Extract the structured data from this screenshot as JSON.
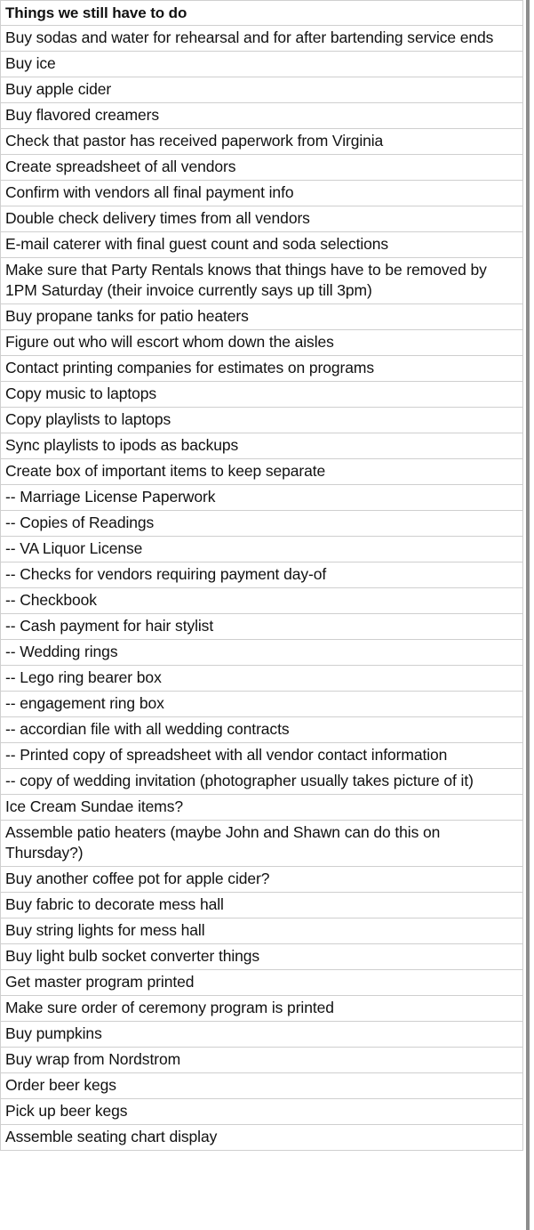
{
  "document": {
    "title": "Things we still have to do",
    "kind": "checklist-table",
    "column_count": 1
  },
  "table": {
    "header": "Things we still have to do",
    "rows": [
      "Buy sodas and water for rehearsal and for after bartending service ends",
      "Buy ice",
      "Buy apple cider",
      "Buy flavored creamers",
      "Check that pastor has received paperwork from Virginia",
      "Create spreadsheet of all vendors",
      "Confirm with vendors all final payment info",
      "Double check delivery times from all vendors",
      "E-mail caterer with final guest count and soda selections",
      "Make sure that Party Rentals knows that things have to be removed by 1PM Saturday (their invoice currently says up till 3pm)",
      "Buy propane tanks for patio heaters",
      "Figure out who will escort whom down the aisles",
      "Contact printing companies for estimates on programs",
      "Copy music to laptops",
      "Copy playlists to laptops",
      "Sync playlists to ipods as backups",
      "Create box of important items to keep separate",
      "-- Marriage License Paperwork",
      "-- Copies of Readings",
      "-- VA Liquor License",
      "-- Checks for vendors requiring payment day-of",
      "-- Checkbook",
      "-- Cash payment for hair stylist",
      "-- Wedding rings",
      "-- Lego ring bearer box",
      "-- engagement ring box",
      "-- accordian file with all wedding contracts",
      "-- Printed copy of spreadsheet with all vendor contact information",
      "-- copy of wedding invitation (photographer usually takes picture of it)",
      "Ice Cream Sundae items?",
      "Assemble patio heaters (maybe John and Shawn can do this on Thursday?)",
      "Buy another coffee pot for apple cider?",
      "Buy fabric to decorate mess hall",
      "Buy string lights for mess hall",
      "Buy light bulb socket converter things",
      "Get master program printed",
      "Make sure order of ceremony program is printed",
      "Buy pumpkins",
      "Buy wrap from Nordstrom",
      "Order beer kegs",
      "Pick up beer kegs",
      "Assemble seating chart display"
    ]
  },
  "colors": {
    "text": "#111111",
    "cell_border": "#cfcfcf",
    "background": "#ffffff",
    "edge_shadow": "#8d8d8d"
  }
}
